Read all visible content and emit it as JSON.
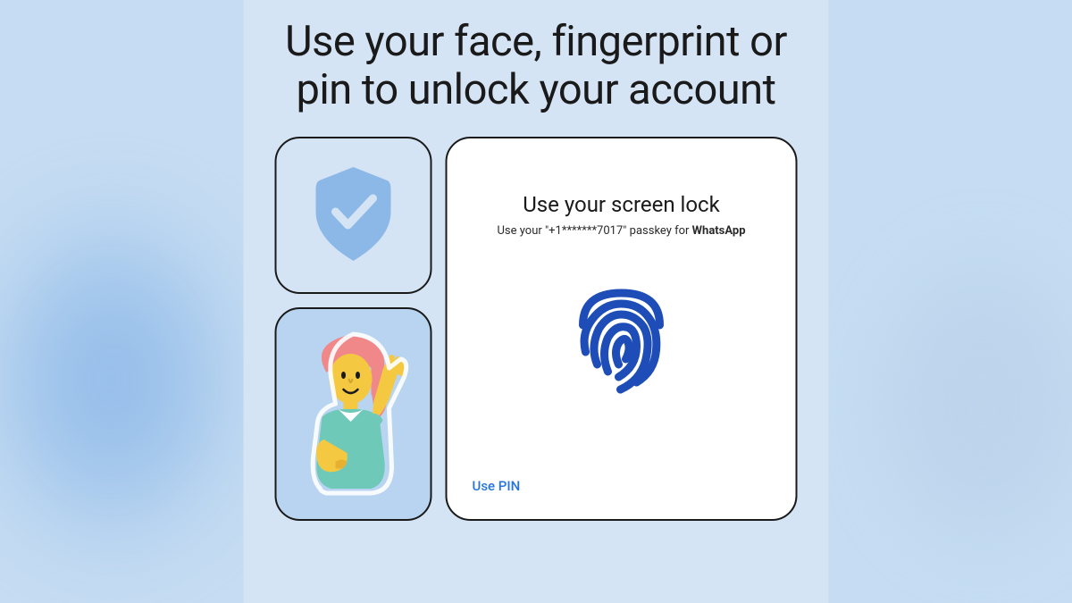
{
  "headline": "Use your face, fingerprint or pin to unlock your account",
  "main": {
    "title": "Use your screen lock",
    "sub_prefix": "Use your \"",
    "phone": "+1*******7017",
    "sub_middle": "\" passkey for ",
    "app": "WhatsApp",
    "use_pin": "Use PIN"
  },
  "icons": {
    "shield": "shield-check-icon",
    "fingerprint": "fingerprint-icon",
    "person": "waving-person-illustration"
  },
  "colors": {
    "accent": "#2374e1",
    "shield": "#8cb8e8",
    "fingerprint": "#1e4db7"
  }
}
